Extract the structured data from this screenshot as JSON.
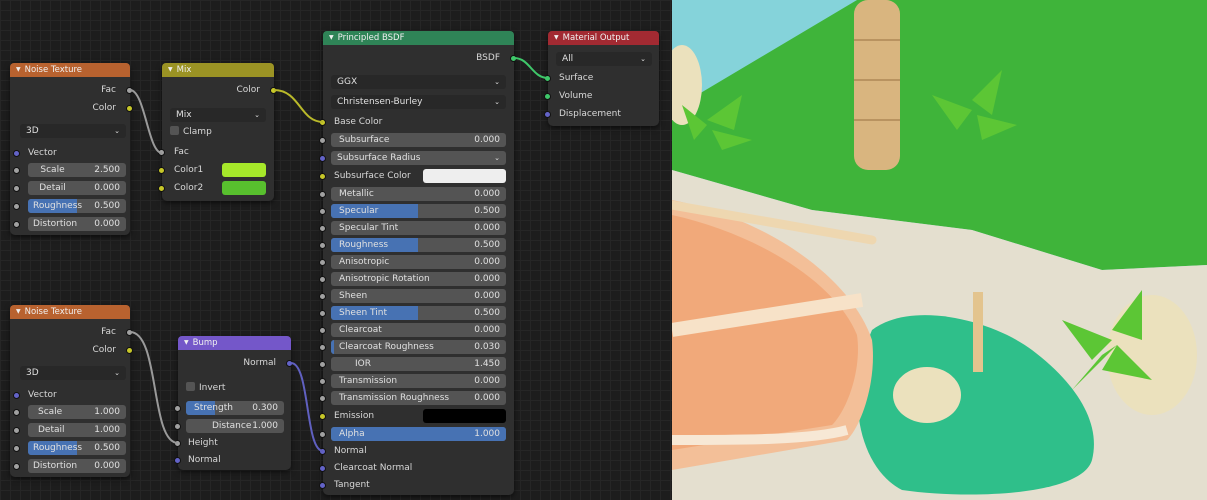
{
  "noise1": {
    "title": "Noise Texture",
    "out_fac": "Fac",
    "out_color": "Color",
    "dimension": "3D",
    "vector": "Vector",
    "scale_label": "Scale",
    "scale_value": "2.500",
    "detail_label": "Detail",
    "detail_value": "0.000",
    "roughness_label": "Roughness",
    "roughness_value": "0.500",
    "distortion_label": "Distortion",
    "distortion_value": "0.000"
  },
  "noise2": {
    "title": "Noise Texture",
    "out_fac": "Fac",
    "out_color": "Color",
    "dimension": "3D",
    "vector": "Vector",
    "scale_label": "Scale",
    "scale_value": "1.000",
    "detail_label": "Detail",
    "detail_value": "1.000",
    "roughness_label": "Roughness",
    "roughness_value": "0.500",
    "distortion_label": "Distortion",
    "distortion_value": "0.000"
  },
  "mix": {
    "title": "Mix",
    "out_color": "Color",
    "blend_mode": "Mix",
    "clamp": "Clamp",
    "fac": "Fac",
    "color1": "Color1",
    "color2": "Color2",
    "color1_hex": "#a6e82a",
    "color2_hex": "#58c02e"
  },
  "bump": {
    "title": "Bump",
    "out_normal": "Normal",
    "invert": "Invert",
    "strength_label": "Strength",
    "strength_value": "0.300",
    "distance_label": "Distance",
    "distance_value": "1.000",
    "height": "Height",
    "normal": "Normal"
  },
  "bsdf": {
    "title": "Principled BSDF",
    "out": "BSDF",
    "distribution": "GGX",
    "subsurface_method": "Christensen-Burley",
    "base_color": "Base Color",
    "subsurface_label": "Subsurface",
    "subsurface_value": "0.000",
    "subsurface_radius": "Subsurface Radius",
    "subsurface_color": "Subsurface Color",
    "subsurface_color_hex": "#eeeeee",
    "metallic_label": "Metallic",
    "metallic_value": "0.000",
    "specular_label": "Specular",
    "specular_value": "0.500",
    "specular_tint_label": "Specular Tint",
    "specular_tint_value": "0.000",
    "roughness_label": "Roughness",
    "roughness_value": "0.500",
    "anisotropic_label": "Anisotropic",
    "anisotropic_value": "0.000",
    "anisotropic_rotation_label": "Anisotropic Rotation",
    "anisotropic_rotation_value": "0.000",
    "sheen_label": "Sheen",
    "sheen_value": "0.000",
    "sheen_tint_label": "Sheen Tint",
    "sheen_tint_value": "0.500",
    "clearcoat_label": "Clearcoat",
    "clearcoat_value": "0.000",
    "clearcoat_roughness_label": "Clearcoat Roughness",
    "clearcoat_roughness_value": "0.030",
    "ior_label": "IOR",
    "ior_value": "1.450",
    "transmission_label": "Transmission",
    "transmission_value": "0.000",
    "transmission_roughness_label": "Transmission Roughness",
    "transmission_roughness_value": "0.000",
    "emission": "Emission",
    "emission_hex": "#000000",
    "alpha_label": "Alpha",
    "alpha_value": "1.000",
    "normal": "Normal",
    "clearcoat_normal": "Clearcoat Normal",
    "tangent": "Tangent"
  },
  "output": {
    "title": "Material Output",
    "target": "All",
    "surface": "Surface",
    "volume": "Volume",
    "displacement": "Displacement"
  },
  "colors": {
    "field_fill": "#4772b3",
    "socket_grey": "#a1a1a1",
    "socket_yellow": "#c7c729",
    "socket_purple": "#6363c7",
    "socket_green": "#3fc76a",
    "water": "#2fbf8a",
    "sky": "#85d3da",
    "grass": "#3fb43a",
    "sand": "#e4dfcf"
  }
}
